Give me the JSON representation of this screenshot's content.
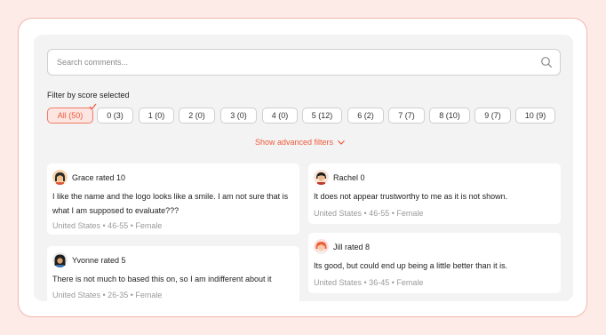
{
  "search": {
    "placeholder": "Search comments..."
  },
  "filter_label": "Filter by score selected",
  "chips": [
    "All (50)",
    "0 (3)",
    "1 (0)",
    "2 (0)",
    "3 (0)",
    "4 (0)",
    "5 (12)",
    "6 (2)",
    "7 (7)",
    "8 (10)",
    "9 (7)",
    "10 (9)"
  ],
  "advanced_filters_label": "Show advanced filters",
  "colors": {
    "accent": "#ee5a3c",
    "page_bg": "#fdebe8",
    "panel_bg": "#f3f3f3"
  },
  "comments": {
    "c1": {
      "name_line": "Grace rated 10",
      "text1": "I like the name and the logo looks like a smile. I am not sure that is",
      "text2": "what I am supposed to evaluate???",
      "meta": "United States • 46-55 • Female"
    },
    "c2": {
      "name_line": "Yvonne rated 5",
      "text1": "There is not much to based this on, so I am indifferent about it",
      "meta": "United States • 26-35 • Female"
    },
    "c3": {
      "name_line": "Rachel 0",
      "text1": "It does not appear trustworthy to me as it is not shown.",
      "meta": "United States • 46-55 • Female"
    },
    "c4": {
      "name_line": "Jill rated 8",
      "text1": "Its good, but could end up being a little better than it is.",
      "meta": "United States • 36-45 • Female"
    }
  }
}
